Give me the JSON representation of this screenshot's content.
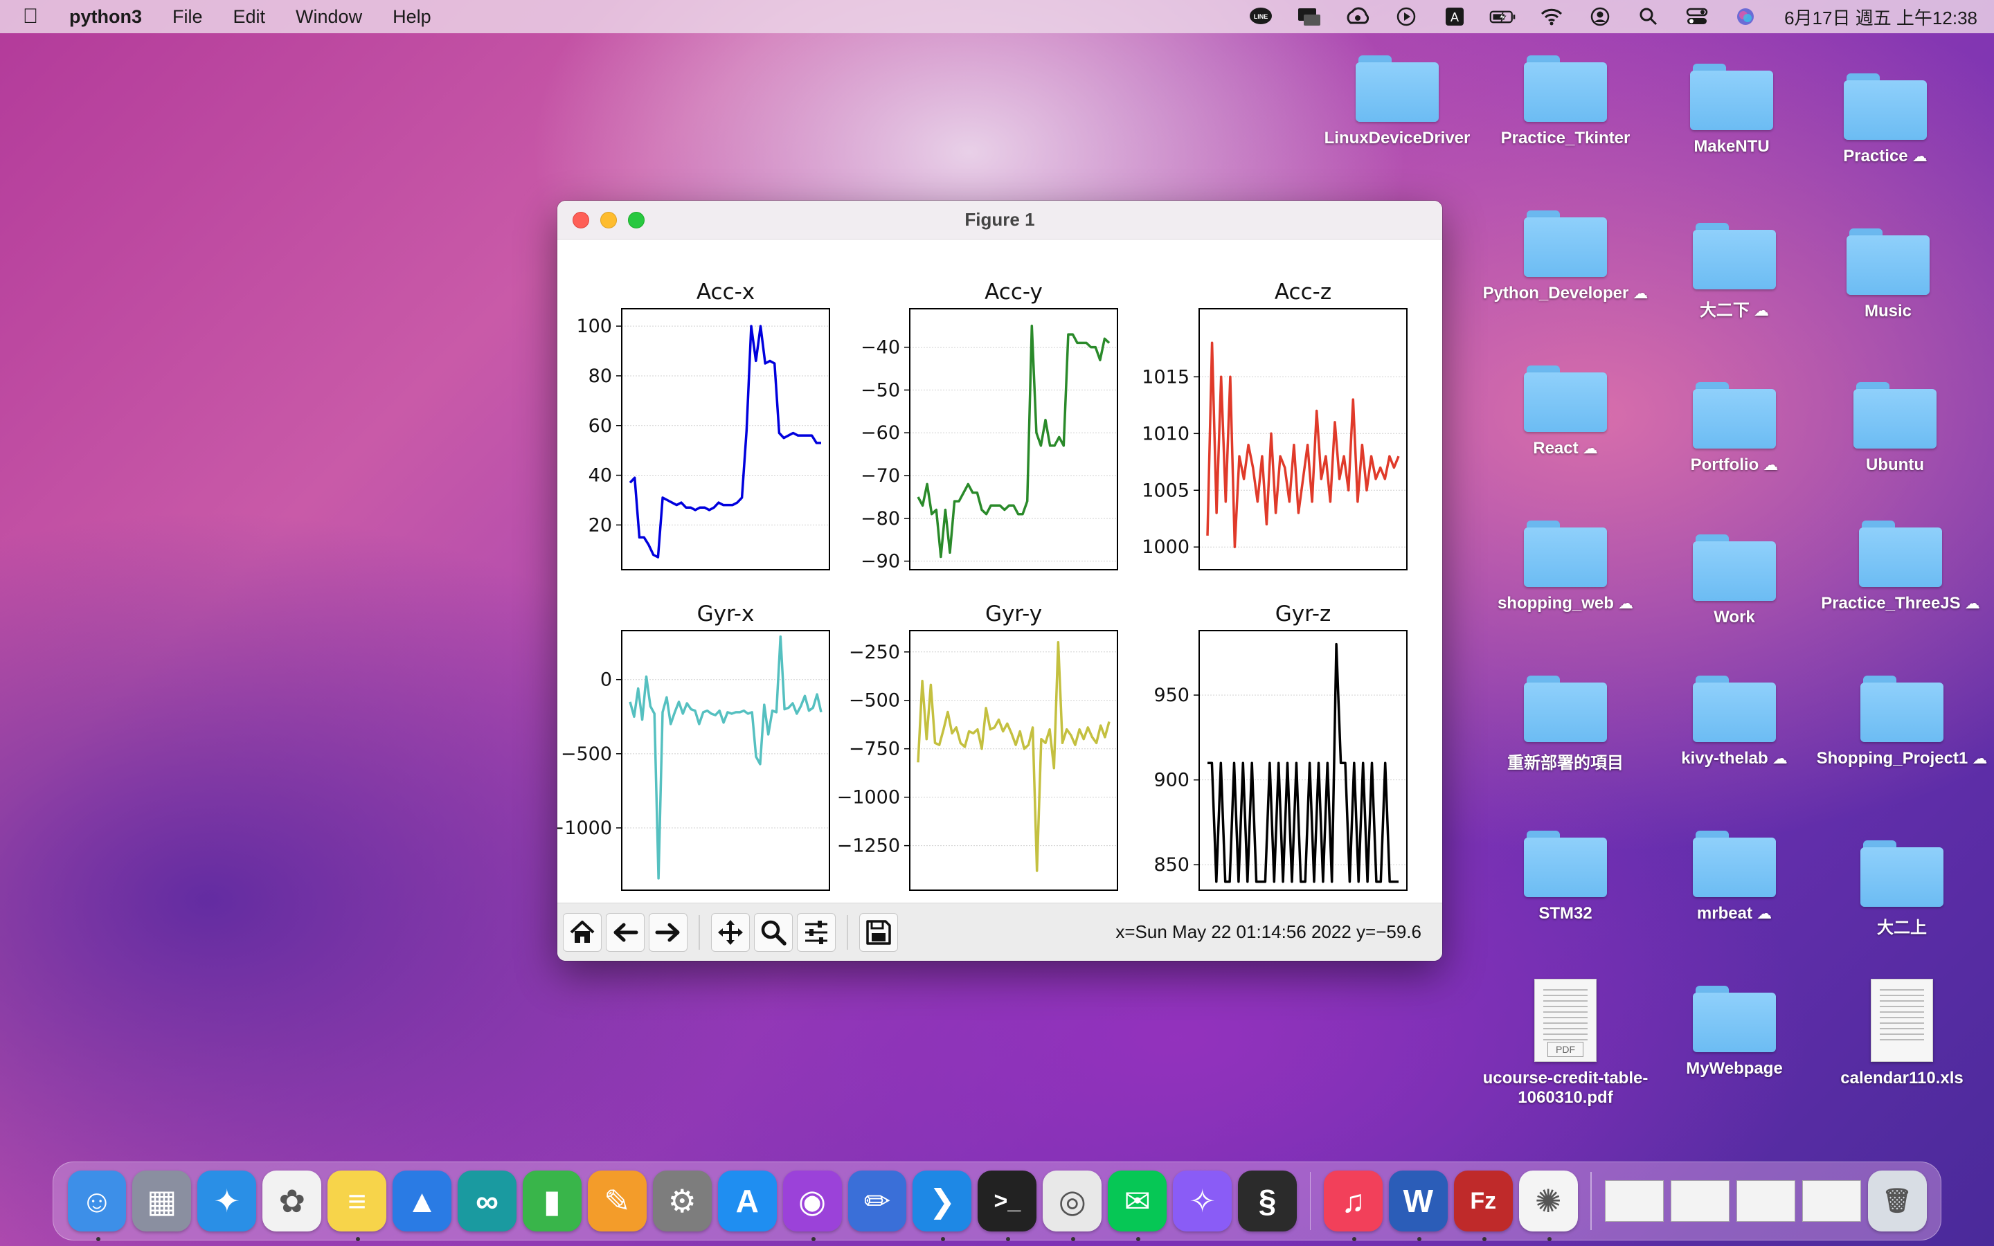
{
  "menubar": {
    "app_name": "python3",
    "items": [
      "File",
      "Edit",
      "Window",
      "Help"
    ],
    "status_icons": [
      "line-icon",
      "display-icon",
      "creative-cloud-icon",
      "play-icon",
      "input-source-icon",
      "battery-icon",
      "wifi-icon",
      "user-icon",
      "search-icon",
      "control-center-icon",
      "siri-icon"
    ],
    "input_source_label": "A",
    "line_label": "LINE",
    "clock": "6月17日 週五 上午12:38"
  },
  "window": {
    "title": "Figure 1",
    "coords": "x=Sun May 22 01:14:56 2022 y=−59.6",
    "toolbar": [
      "home-icon",
      "back-icon",
      "forward-icon",
      "pan-icon",
      "zoom-icon",
      "configure-subplots-icon",
      "save-icon"
    ]
  },
  "chart_data": [
    {
      "type": "line",
      "title": "Acc-x",
      "color": "#0000dd",
      "ylim": [
        2,
        107
      ],
      "yticks": [
        20,
        40,
        60,
        80,
        100
      ],
      "values": [
        37,
        39,
        15,
        15,
        12,
        8,
        7,
        31,
        30,
        29,
        28,
        29,
        27,
        27,
        26,
        27,
        27,
        26,
        27,
        29,
        28,
        28,
        28,
        29,
        31,
        58,
        100,
        86,
        100,
        85,
        86,
        85,
        57,
        55,
        56,
        57,
        56,
        56,
        56,
        56,
        53,
        53
      ]
    },
    {
      "type": "line",
      "title": "Acc-y",
      "color": "#2a8a2a",
      "ylim": [
        -92,
        -31
      ],
      "yticks": [
        -40,
        -50,
        -60,
        -70,
        -80,
        -90
      ],
      "values": [
        -75,
        -77,
        -72,
        -79,
        -78,
        -89,
        -78,
        -88,
        -76,
        -76,
        -74,
        -72,
        -74,
        -74,
        -78,
        -79,
        -77,
        -77,
        -77,
        -78,
        -77,
        -77,
        -79,
        -79,
        -76,
        -35,
        -60,
        -63,
        -57,
        -63,
        -63,
        -61,
        -63,
        -37,
        -37,
        -39,
        -39,
        -39,
        -40,
        -40,
        -43,
        -38,
        -39
      ]
    },
    {
      "type": "line",
      "title": "Acc-z",
      "color": "#e03a2a",
      "ylim": [
        998,
        1021
      ],
      "yticks": [
        1000,
        1005,
        1010,
        1015
      ],
      "values": [
        1001,
        1018,
        1003,
        1015,
        1004,
        1015,
        1000,
        1008,
        1006,
        1009,
        1007,
        1004,
        1008,
        1002,
        1010,
        1003,
        1008,
        1007,
        1004,
        1009,
        1003,
        1006,
        1009,
        1004,
        1012,
        1006,
        1008,
        1004,
        1011,
        1006,
        1008,
        1005,
        1013,
        1004,
        1009,
        1005,
        1008,
        1006,
        1007,
        1006,
        1008,
        1007,
        1008
      ]
    },
    {
      "type": "line",
      "title": "Gyr-x",
      "color": "#55c0c0",
      "ylim": [
        -1420,
        330
      ],
      "yticks": [
        0,
        -500,
        -1000
      ],
      "values": [
        -150,
        -250,
        -60,
        -270,
        20,
        -180,
        -230,
        -1340,
        -220,
        -120,
        -300,
        -220,
        -150,
        -230,
        -160,
        -200,
        -210,
        -300,
        -220,
        -210,
        -230,
        -240,
        -210,
        -290,
        -220,
        -230,
        -220,
        -220,
        -210,
        -230,
        -220,
        -520,
        -570,
        -170,
        -370,
        -210,
        -220,
        290,
        -200,
        -190,
        -160,
        -230,
        -180,
        -110,
        -210,
        -190,
        -100,
        -220
      ]
    },
    {
      "type": "line",
      "title": "Gyr-y",
      "color": "#c4c040",
      "ylim": [
        -1480,
        -140
      ],
      "yticks": [
        -250,
        -500,
        -750,
        -1000,
        -1250
      ],
      "values": [
        -820,
        -400,
        -700,
        -420,
        -720,
        -730,
        -650,
        -560,
        -670,
        -640,
        -720,
        -740,
        -660,
        -670,
        -650,
        -750,
        -540,
        -650,
        -640,
        -600,
        -660,
        -620,
        -670,
        -730,
        -660,
        -750,
        -730,
        -640,
        -1380,
        -700,
        -720,
        -650,
        -850,
        -200,
        -720,
        -650,
        -680,
        -730,
        -650,
        -700,
        -640,
        -690,
        -720,
        -630,
        -690,
        -610
      ]
    },
    {
      "type": "line",
      "title": "Gyr-z",
      "color": "#000000",
      "ylim": [
        835,
        988
      ],
      "yticks": [
        850,
        900,
        950
      ],
      "values": [
        910,
        910,
        840,
        910,
        840,
        840,
        910,
        840,
        910,
        840,
        910,
        840,
        840,
        840,
        910,
        840,
        910,
        840,
        910,
        840,
        910,
        840,
        840,
        910,
        840,
        910,
        840,
        910,
        840,
        980,
        910,
        910,
        840,
        910,
        840,
        910,
        840,
        910,
        840,
        840,
        910,
        840,
        840,
        840
      ]
    }
  ],
  "desktop": {
    "items": [
      {
        "label": "LinuxDeviceDriver",
        "type": "folder",
        "cloud": false
      },
      {
        "label": "Practice_Tkinter",
        "type": "folder",
        "cloud": false
      },
      {
        "label": "MakeNTU",
        "type": "folder",
        "cloud": false
      },
      {
        "label": "Practice",
        "type": "folder",
        "cloud": true
      },
      {
        "label": "Python_Developer",
        "type": "folder",
        "cloud": true
      },
      {
        "label": "大二下",
        "type": "folder",
        "cloud": true
      },
      {
        "label": "Music",
        "type": "folder",
        "cloud": false
      },
      {
        "label": "React",
        "type": "folder",
        "cloud": true
      },
      {
        "label": "Portfolio",
        "type": "folder",
        "cloud": true
      },
      {
        "label": "Ubuntu",
        "type": "folder",
        "cloud": false
      },
      {
        "label": "shopping_web",
        "type": "folder",
        "cloud": true
      },
      {
        "label": "Work",
        "type": "folder",
        "cloud": false
      },
      {
        "label": "Practice_ThreeJS",
        "type": "folder",
        "cloud": true
      },
      {
        "label": "重新部署的項目",
        "type": "folder",
        "cloud": false
      },
      {
        "label": "kivy-thelab",
        "type": "folder",
        "cloud": true
      },
      {
        "label": "Shopping_Project1",
        "type": "folder",
        "cloud": true
      },
      {
        "label": "STM32",
        "type": "folder",
        "cloud": false
      },
      {
        "label": "mrbeat",
        "type": "folder",
        "cloud": true
      },
      {
        "label": "大二上",
        "type": "folder",
        "cloud": false
      },
      {
        "label": "ucourse-credit-table-1060310.pdf",
        "type": "pdf",
        "cloud": false,
        "tag": "PDF"
      },
      {
        "label": "MyWebpage",
        "type": "folder",
        "cloud": false
      },
      {
        "label": "calendar110.xls",
        "type": "xls",
        "cloud": false
      }
    ]
  },
  "dock": {
    "apps": [
      {
        "name": "finder-icon",
        "color": "#3d8fe8",
        "glyph": "☺",
        "running": true
      },
      {
        "name": "launchpad-icon",
        "color": "#8a8fa0",
        "glyph": "▦",
        "running": false
      },
      {
        "name": "safari-icon",
        "color": "#2a8fe6",
        "glyph": "✦",
        "running": false
      },
      {
        "name": "photos-icon",
        "color": "#f2f2f2",
        "glyph": "✿",
        "running": false
      },
      {
        "name": "notes-icon",
        "color": "#f7d44a",
        "glyph": "≡",
        "running": true
      },
      {
        "name": "keynote-icon",
        "color": "#2a7be4",
        "glyph": "▲",
        "running": false
      },
      {
        "name": "arduino-icon",
        "color": "#1a9aa0",
        "glyph": "∞",
        "running": false
      },
      {
        "name": "numbers-icon",
        "color": "#39b54a",
        "glyph": "▮",
        "running": false
      },
      {
        "name": "pages-icon",
        "color": "#f39c2a",
        "glyph": "✎",
        "running": false
      },
      {
        "name": "system-preferences-icon",
        "color": "#7d7d7d",
        "glyph": "⚙",
        "running": false
      },
      {
        "name": "app-store-icon",
        "color": "#1f8ef1",
        "glyph": "A",
        "running": false
      },
      {
        "name": "podcasts-icon",
        "color": "#9b42d9",
        "glyph": "◉",
        "running": true
      },
      {
        "name": "sketchbook-icon",
        "color": "#3a6fd8",
        "glyph": "✏",
        "running": false
      },
      {
        "name": "vscode-icon",
        "color": "#1e88e5",
        "glyph": "❯",
        "running": true
      },
      {
        "name": "terminal-icon",
        "color": "#222222",
        "glyph": ">_",
        "running": true
      },
      {
        "name": "chrome-icon",
        "color": "#e8e8e8",
        "glyph": "◎",
        "running": true
      },
      {
        "name": "line-icon",
        "color": "#06c755",
        "glyph": "✉",
        "running": true
      },
      {
        "name": "messenger-icon",
        "color": "#8a5cf6",
        "glyph": "✧",
        "running": false
      },
      {
        "name": "scrivener-icon",
        "color": "#2b2b2b",
        "glyph": "§",
        "running": false
      }
    ],
    "apps_right": [
      {
        "name": "music-icon",
        "color": "#f2405a",
        "glyph": "♫",
        "running": true
      },
      {
        "name": "word-icon",
        "color": "#2b5db8",
        "glyph": "W",
        "running": true
      },
      {
        "name": "filezilla-icon",
        "color": "#bf2a2a",
        "glyph": "Fz",
        "running": true
      },
      {
        "name": "python-rocket-icon",
        "color": "#f4f4f4",
        "glyph": "✺",
        "running": true
      }
    ],
    "trash": {
      "name": "trash-icon",
      "color": "#d8dde4",
      "glyph": "🗑"
    }
  }
}
